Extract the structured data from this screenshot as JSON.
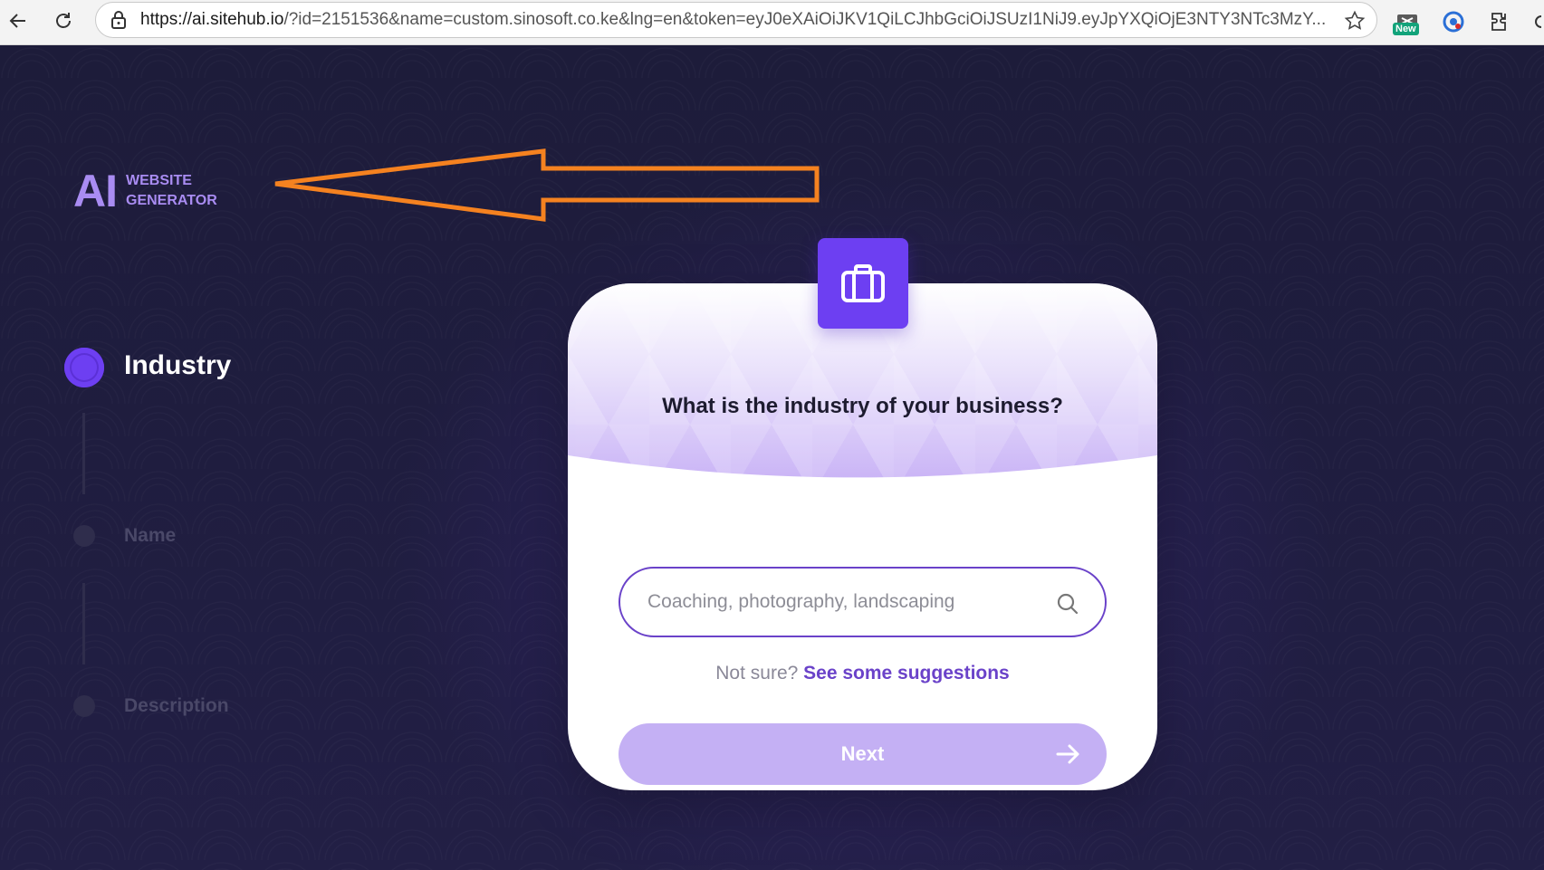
{
  "browser": {
    "url_host": "https://ai.sitehub.io",
    "url_rest": "/?id=2151536&name=custom.sinosoft.co.ke&lng=en&token=eyJ0eXAiOiJKV1QiLCJhbGciOiJSUzI1NiJ9.eyJpYXQiOjE3NTY3NTc3MzY...",
    "ext_badge": "New",
    "icons": [
      "back-arrow-icon",
      "reload-icon",
      "lock-icon",
      "star-icon",
      "extension-new-icon",
      "target-icon",
      "puzzle-icon"
    ]
  },
  "logo": {
    "mark": "AI",
    "line1": "WEBSITE",
    "line2": "GENERATOR"
  },
  "steps": [
    {
      "label": "Industry",
      "active": true
    },
    {
      "label": "Name",
      "active": false
    },
    {
      "label": "Description",
      "active": false
    }
  ],
  "card": {
    "question": "What is the industry of your business?",
    "search_placeholder": "Coaching, photography, landscaping",
    "not_sure": "Not sure?",
    "suggestions_link": "See some suggestions",
    "next_label": "Next"
  },
  "colors": {
    "accent": "#6d3ff2",
    "annotation_arrow": "#f58220",
    "next_button": "#c4b0f4"
  }
}
